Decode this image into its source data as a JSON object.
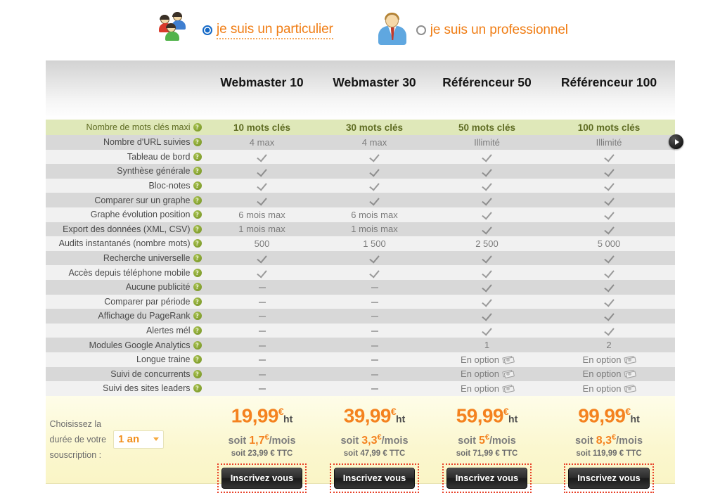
{
  "audience": {
    "options": [
      {
        "label": "je suis un particulier",
        "icon": "people-group-icon",
        "selected": true
      },
      {
        "label": "je suis un professionnel",
        "icon": "businessman-icon",
        "selected": false
      }
    ]
  },
  "table": {
    "columns": [
      {
        "header": ""
      },
      {
        "header": "Webmaster 10"
      },
      {
        "header": "Webmaster 30"
      },
      {
        "header": "Référenceur 50"
      },
      {
        "header": "Référenceur 100"
      }
    ],
    "scroll_arrow_icon": "chevron-right-icon",
    "help_icon": "help-question-icon",
    "rows": [
      {
        "label": "Nombre de mots clés maxi",
        "highlight": true,
        "values": [
          "10 mots clés",
          "30 mots clés",
          "50 mots clés",
          "100 mots clés"
        ]
      },
      {
        "label": "Nombre d'URL suivies",
        "highlight": false,
        "values": [
          "4 max",
          "4 max",
          "Illimité",
          "Illimité"
        ]
      },
      {
        "label": "Tableau de bord",
        "highlight": false,
        "values": [
          "check",
          "check",
          "check",
          "check"
        ]
      },
      {
        "label": "Synthèse générale",
        "highlight": false,
        "values": [
          "check",
          "check",
          "check",
          "check"
        ]
      },
      {
        "label": "Bloc-notes",
        "highlight": false,
        "values": [
          "check",
          "check",
          "check",
          "check"
        ]
      },
      {
        "label": "Comparer sur un graphe",
        "highlight": false,
        "values": [
          "check",
          "check",
          "check",
          "check"
        ]
      },
      {
        "label": "Graphe évolution position",
        "highlight": false,
        "values": [
          "6 mois max",
          "6 mois max",
          "check",
          "check"
        ]
      },
      {
        "label": "Export des données (XML, CSV)",
        "highlight": false,
        "values": [
          "1 mois max",
          "1 mois max",
          "check",
          "check"
        ]
      },
      {
        "label": "Audits instantanés (nombre mots)",
        "highlight": false,
        "values": [
          "500",
          "1 500",
          "2 500",
          "5 000"
        ]
      },
      {
        "label": "Recherche universelle",
        "highlight": false,
        "values": [
          "check",
          "check",
          "check",
          "check"
        ]
      },
      {
        "label": "Accès depuis téléphone mobile",
        "highlight": false,
        "values": [
          "check",
          "check",
          "check",
          "check"
        ]
      },
      {
        "label": "Aucune publicité",
        "highlight": false,
        "values": [
          "dash",
          "dash",
          "check",
          "check"
        ]
      },
      {
        "label": "Comparer par période",
        "highlight": false,
        "values": [
          "dash",
          "dash",
          "check",
          "check"
        ]
      },
      {
        "label": "Affichage du PageRank",
        "highlight": false,
        "values": [
          "dash",
          "dash",
          "check",
          "check"
        ]
      },
      {
        "label": "Alertes mél",
        "highlight": false,
        "values": [
          "dash",
          "dash",
          "check",
          "check"
        ]
      },
      {
        "label": "Modules Google Analytics",
        "highlight": false,
        "values": [
          "dash",
          "dash",
          "1",
          "2"
        ]
      },
      {
        "label": "Longue traine",
        "highlight": false,
        "values": [
          "dash",
          "dash",
          "option",
          "option"
        ]
      },
      {
        "label": "Suivi de concurrents",
        "highlight": false,
        "values": [
          "dash",
          "dash",
          "option",
          "option"
        ]
      },
      {
        "label": "Suivi des sites leaders",
        "highlight": false,
        "values": [
          "dash",
          "dash",
          "option",
          "option"
        ]
      }
    ],
    "option_label": "En option",
    "option_icon": "money-banknote-icon"
  },
  "footer": {
    "duration_line1": "Choisissez la",
    "duration_line2": "durée de votre",
    "duration_line3": "souscription :",
    "duration_value": "1 an",
    "duration_chevron_icon": "chevron-down-icon",
    "plans": [
      {
        "price": "19,99",
        "currency": "€",
        "tax_suffix": "ht",
        "monthly_prefix": "soit",
        "monthly_amount": "1,7",
        "monthly_suffix": "/mois",
        "ttc": "soit 23,99 € TTC",
        "cta": "Inscrivez vous"
      },
      {
        "price": "39,99",
        "currency": "€",
        "tax_suffix": "ht",
        "monthly_prefix": "soit",
        "monthly_amount": "3,3",
        "monthly_suffix": "/mois",
        "ttc": "soit 47,99 € TTC",
        "cta": "Inscrivez vous"
      },
      {
        "price": "59,99",
        "currency": "€",
        "tax_suffix": "ht",
        "monthly_prefix": "soit",
        "monthly_amount": "5",
        "monthly_suffix": "/mois",
        "ttc": "soit 71,99 € TTC",
        "cta": "Inscrivez vous"
      },
      {
        "price": "99,99",
        "currency": "€",
        "tax_suffix": "ht",
        "monthly_prefix": "soit",
        "monthly_amount": "8,3",
        "monthly_suffix": "/mois",
        "ttc": "soit 119,99 € TTC",
        "cta": "Inscrivez vous"
      }
    ]
  },
  "colors": {
    "accent_orange": "#f4821f",
    "highlight_green": "#dfe8b9",
    "row_odd": "#f1f1f1",
    "row_even": "#d8d8d8",
    "footer_yellow": "#fbf7cf",
    "radio_blue": "#1569c7"
  }
}
